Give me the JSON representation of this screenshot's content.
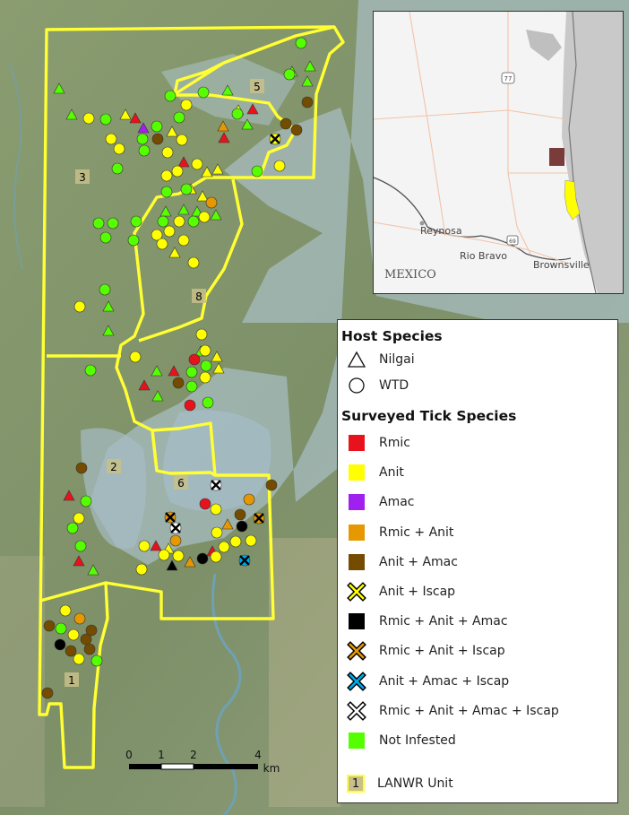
{
  "map": {
    "unit_labels": [
      {
        "name": "1",
        "kind": "unit"
      },
      {
        "name": "2",
        "kind": "unit"
      },
      {
        "name": "3",
        "kind": "unit"
      },
      {
        "name": "5",
        "kind": "unit"
      },
      {
        "name": "6",
        "kind": "unit"
      },
      {
        "name": "8",
        "kind": "unit"
      }
    ],
    "scalebar": {
      "ticks": [
        "0",
        "1",
        "2",
        "4"
      ],
      "unit": "km"
    },
    "colors": {
      "rmic": "#e8121c",
      "anit": "#ffff00",
      "amac": "#a020f0",
      "rmic_anit": "#e69800",
      "anit_amac": "#734c00",
      "anit_iscap": "#ffff00",
      "rmic_anit_amac": "#000000",
      "rmic_anit_iscap": "#e69800",
      "anit_amac_iscap": "#00a9e6",
      "all_four": "#ffffff",
      "not_infested": "#55ff00",
      "boundary": "#ffff33"
    }
  },
  "inset": {
    "place_labels": [
      "Reynosa",
      "Rio Bravo",
      "Brownsville",
      "MEXICO"
    ],
    "shields": [
      "77",
      "69"
    ]
  },
  "legend": {
    "host_title": "Host Species",
    "hosts": [
      {
        "label": "Nilgai",
        "shape": "triangle"
      },
      {
        "label": "WTD",
        "shape": "circle"
      }
    ],
    "tick_title": "Surveyed Tick Species",
    "species": [
      {
        "label": "Rmic",
        "color": "#e8121c",
        "marker": "square"
      },
      {
        "label": "Anit",
        "color": "#ffff00",
        "marker": "square"
      },
      {
        "label": "Amac",
        "color": "#a020f0",
        "marker": "square"
      },
      {
        "label": "Rmic + Anit",
        "color": "#e69800",
        "marker": "square"
      },
      {
        "label": "Anit + Amac",
        "color": "#734c00",
        "marker": "square"
      },
      {
        "label": "Anit + Iscap",
        "color": "#ffff00",
        "marker": "x"
      },
      {
        "label": "Rmic + Anit + Amac",
        "color": "#000000",
        "marker": "square"
      },
      {
        "label": "Rmic + Anit + Iscap",
        "color": "#e69800",
        "marker": "x"
      },
      {
        "label": "Anit + Amac + Iscap",
        "color": "#00a9e6",
        "marker": "x"
      },
      {
        "label": "Rmic + Anit + Amac + Iscap",
        "color": "#ffffff",
        "marker": "x"
      },
      {
        "label": "Not Infested",
        "color": "#55ff00",
        "marker": "square"
      }
    ],
    "unit_label": "LANWR Unit",
    "unit_sample": "1"
  }
}
